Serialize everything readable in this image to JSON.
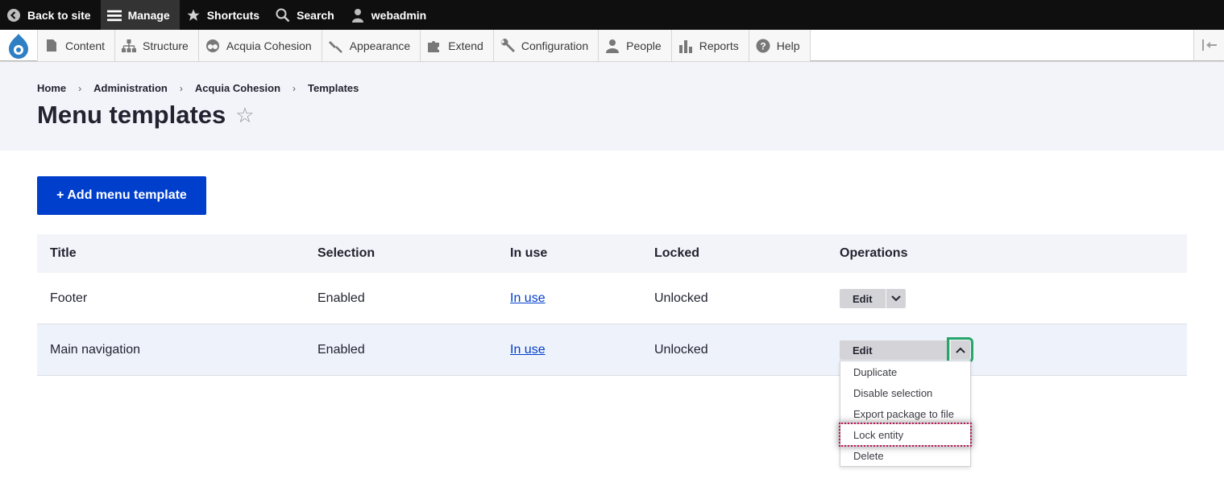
{
  "toolbar": {
    "back": "Back to site",
    "manage": "Manage",
    "shortcuts": "Shortcuts",
    "search": "Search",
    "user": "webadmin"
  },
  "admin_menu": {
    "content": "Content",
    "structure": "Structure",
    "acquia": "Acquia Cohesion",
    "appearance": "Appearance",
    "extend": "Extend",
    "configuration": "Configuration",
    "people": "People",
    "reports": "Reports",
    "help": "Help"
  },
  "breadcrumb": [
    "Home",
    "Administration",
    "Acquia Cohesion",
    "Templates"
  ],
  "page_title": "Menu templates",
  "add_button": "+ Add menu template",
  "table": {
    "headers": [
      "Title",
      "Selection",
      "In use",
      "Locked",
      "Operations"
    ],
    "rows": [
      {
        "title": "Footer",
        "selection": "Enabled",
        "in_use": "In use",
        "locked": "Unlocked",
        "op": "Edit"
      },
      {
        "title": "Main navigation",
        "selection": "Enabled",
        "in_use": "In use",
        "locked": "Unlocked",
        "op": "Edit"
      }
    ]
  },
  "dropdown": [
    "Duplicate",
    "Disable selection",
    "Export package to file",
    "Lock entity",
    "Delete"
  ],
  "colors": {
    "primary": "#003ecc",
    "focus": "#26a769",
    "highlight_border": "#c2185b"
  }
}
